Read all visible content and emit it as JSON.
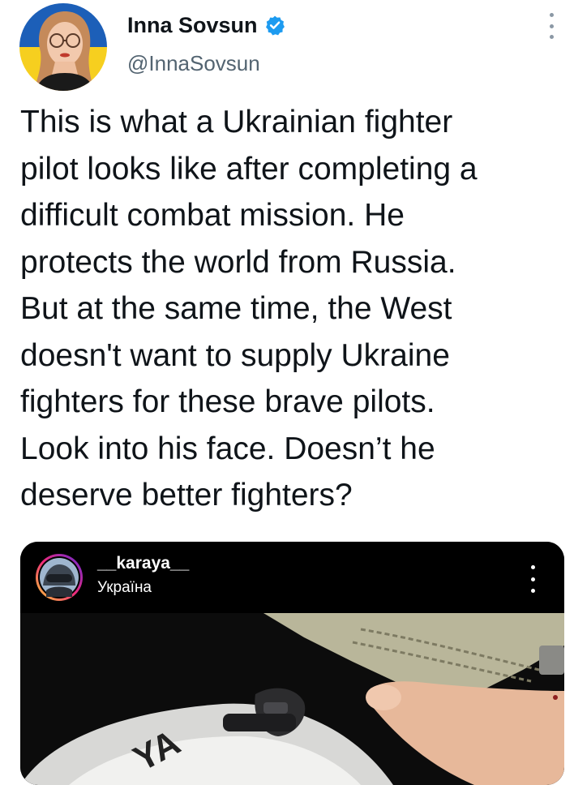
{
  "author": {
    "display_name": "Inna Sovsun",
    "handle": "@InnaSovsun",
    "verified": true,
    "avatar_icon": "profile-photo-woman-glasses",
    "avatar_bg_colors": [
      "#0057b7",
      "#ffd700"
    ]
  },
  "tweet": {
    "text_lines": [
      "This is what a Ukrainian fighter",
      "pilot looks like after completing a",
      "difficult combat mission. He",
      "protects the world from Russia.",
      "But at the same time, the West",
      "doesn't want to supply Ukraine",
      "fighters for these brave pilots.",
      "Look into his face. Doesn’t he",
      "deserve better fighters?"
    ]
  },
  "embedded_post": {
    "username": "__karaya__",
    "location": "Україна",
    "avatar_icon": "pilot-helmet-avatar",
    "more_icon": "vertical-ellipsis-icon",
    "photo_icon": "pilot-helmet-photo",
    "helmet_lettering": "ΥΑ"
  },
  "colors": {
    "text": "#0f1419",
    "secondary_text": "#536471",
    "verified": "#1d9bf0",
    "media_bg": "#000000"
  }
}
